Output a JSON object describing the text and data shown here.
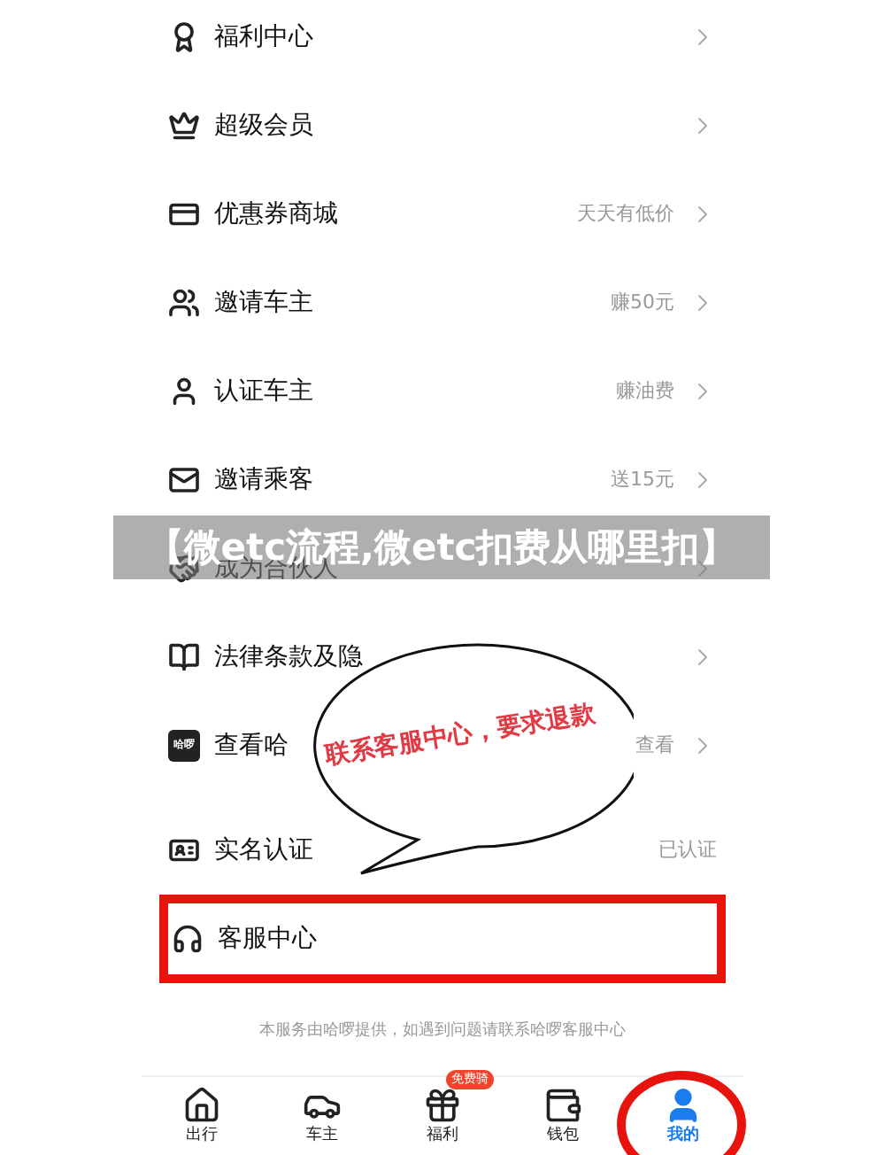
{
  "sections": [
    {
      "items": [
        {
          "label": "福利中心"
        },
        {
          "label": "超级会员"
        },
        {
          "label": "优惠券商城",
          "hint": "天天有低价"
        },
        {
          "label": "邀请车主",
          "hint": "赚50元"
        },
        {
          "label": "认证车主",
          "hint": "赚油费"
        },
        {
          "label": "邀请乘客",
          "hint": "送15元"
        },
        {
          "label": "成为合伙人"
        },
        {
          "label": "法律条款及隐"
        },
        {
          "label": "查看哈",
          "icon_text": "哈啰",
          "hint": "查看"
        }
      ]
    },
    {
      "items": [
        {
          "label": "实名认证",
          "hint": "已认证",
          "chevron": false
        },
        {
          "label": "客服中心",
          "chevron": false,
          "highlighted": true
        }
      ]
    }
  ],
  "footer_note": "本服务由哈啰提供，如遇到问题请联系哈啰客服中心",
  "tabs": [
    {
      "label": "出行",
      "selected": false
    },
    {
      "label": "车主",
      "selected": false
    },
    {
      "label": "福利",
      "badge": "免费骑",
      "selected": false
    },
    {
      "label": "钱包",
      "selected": false
    },
    {
      "label": "我的",
      "selected": true,
      "circled": true
    }
  ],
  "callout": {
    "text": "联系客服中心，要求退款"
  },
  "banner": {
    "title": "【微etc流程,微etc扣费从哪里扣】"
  }
}
